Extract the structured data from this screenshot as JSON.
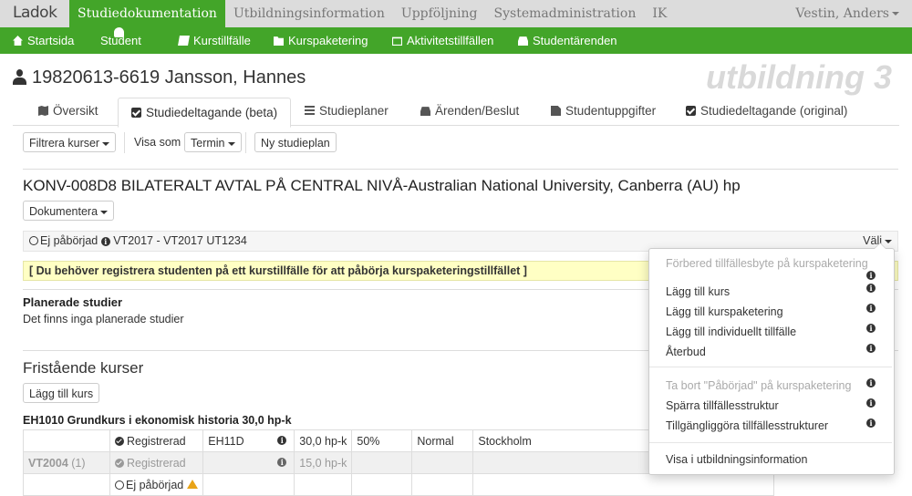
{
  "top": {
    "logo_text": "Ladok",
    "nav": [
      "Studiedokumentation",
      "Utbildningsinformation",
      "Uppföljning",
      "Systemadministration",
      "IK"
    ],
    "user": "Vestin, Anders"
  },
  "green_nav": [
    "Startsida",
    "Student",
    "Kurstillfälle",
    "Kurspaketering",
    "Aktivitetstillfällen",
    "Studentärenden"
  ],
  "student": {
    "heading": "19820613-6619 Jansson, Hannes",
    "environment": "utbildning 3"
  },
  "tabs": [
    "Översikt",
    "Studiedeltagande (beta)",
    "Studieplaner",
    "Ärenden/Beslut",
    "Studentuppgifter",
    "Studiedeltagande (original)"
  ],
  "toolbar": {
    "filter_label": "Filtrera kurser",
    "view_as_label": "Visa som",
    "view_as_value": "Termin",
    "new_plan_label": "Ny studieplan"
  },
  "package": {
    "title": "KONV-008D8 BILATERALT AVTAL PÅ CENTRAL NIVÅ-Australian National University, Canberra (AU) hp",
    "document_label": "Dokumentera",
    "status": "Ej påbörjad",
    "period": "VT2017 - VT2017 UT1234",
    "choose_label": "Välj",
    "warning": "[ Du behöver registrera studenten på ett kurstillfälle för att påbörja kurspaketeringstillfället ]",
    "planned_heading": "Planerade studier",
    "planned_text": "Det finns inga planerade studier"
  },
  "standalone": {
    "heading": "Fristående kurser",
    "add_course_label": "Lägg till kurs",
    "course_heading": "EH1010 Grundkurs i ekonomisk historia 30,0 hp-k",
    "rows": [
      {
        "term": "",
        "status": "Registrerad",
        "code": "EH11D",
        "credits": "30,0 hp-k",
        "pace": "50%",
        "form": "Normal",
        "location": "Stockholm"
      },
      {
        "term": "VT2004",
        "term_count": "(1)",
        "status": "Registrerad",
        "code": "",
        "credits": "15,0 hp-k",
        "pace": "",
        "form": "",
        "location": ""
      },
      {
        "term": "",
        "status": "Ej påbörjad",
        "code": "",
        "credits": "",
        "pace": "",
        "form": "",
        "location": ""
      }
    ]
  },
  "dropdown": {
    "group1": [
      {
        "label": "Förbered tillfällesbyte på kurspaketering",
        "disabled": true
      },
      {
        "label": "Lägg till kurs",
        "disabled": false
      },
      {
        "label": "Lägg till kurspaketering",
        "disabled": false
      },
      {
        "label": "Lägg till individuellt tillfälle",
        "disabled": false
      },
      {
        "label": "Återbud",
        "disabled": false
      }
    ],
    "group2": [
      {
        "label": "Ta bort \"Påbörjad\" på kurspaketering",
        "disabled": true
      },
      {
        "label": "Spärra tillfällesstruktur",
        "disabled": false
      },
      {
        "label": "Tillgängliggöra tillfällesstrukturer",
        "disabled": false
      }
    ],
    "group3": [
      {
        "label": "Visa i utbildningsinformation",
        "disabled": false
      }
    ]
  },
  "colors": {
    "green": "#43a529",
    "topbar": "#dcdcdc",
    "warning_bg": "#ffffc4"
  }
}
